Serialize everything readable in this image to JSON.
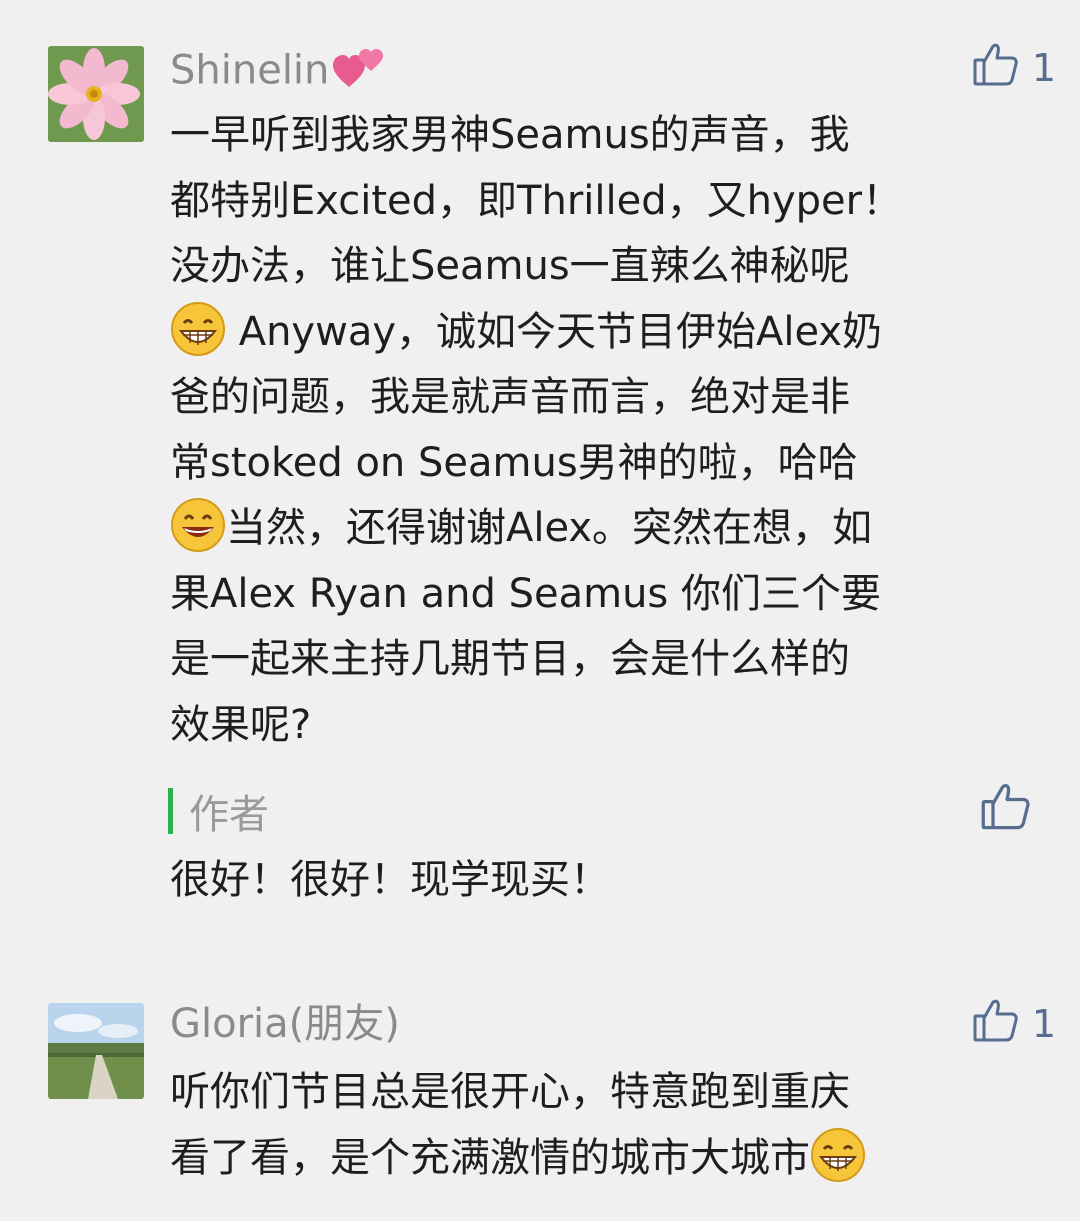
{
  "comments": [
    {
      "user": "Shinelin",
      "user_emoji": "two-hearts",
      "likes": "1",
      "lines": [
        "一早听到我家男神Seamus的声音，我",
        "都特别Excited，即Thrilled，又hyper！",
        "没办法，谁让Seamus一直辣么神秘呢",
        " Anyway，诚如今天节目伊始Alex奶",
        "爸的问题，我是就声音而言，绝对是非",
        "常stoked on Seamus男神的啦，哈哈",
        "当然，还得谢谢Alex。突然在想，如",
        "果Alex Ryan and Seamus 你们三个要",
        "是一起来主持几期节目，会是什么样的",
        "效果呢?"
      ],
      "reply": {
        "label": "作者",
        "text": "很好！很好！现学现买！"
      }
    },
    {
      "user": "Gloria(朋友)",
      "likes": "1",
      "lines": [
        "听你们节目总是很开心，特意跑到重庆",
        "看了看，是个充满激情的城市大城市"
      ]
    }
  ],
  "icons": {
    "like": "thumbs-up-icon",
    "grin": "grin-emoji",
    "smile": "smile-emoji",
    "hearts": "two-hearts-emoji"
  },
  "colors": {
    "like": "#566d8f",
    "author_bar": "#2bb24c",
    "name": "#8a8a8a"
  }
}
